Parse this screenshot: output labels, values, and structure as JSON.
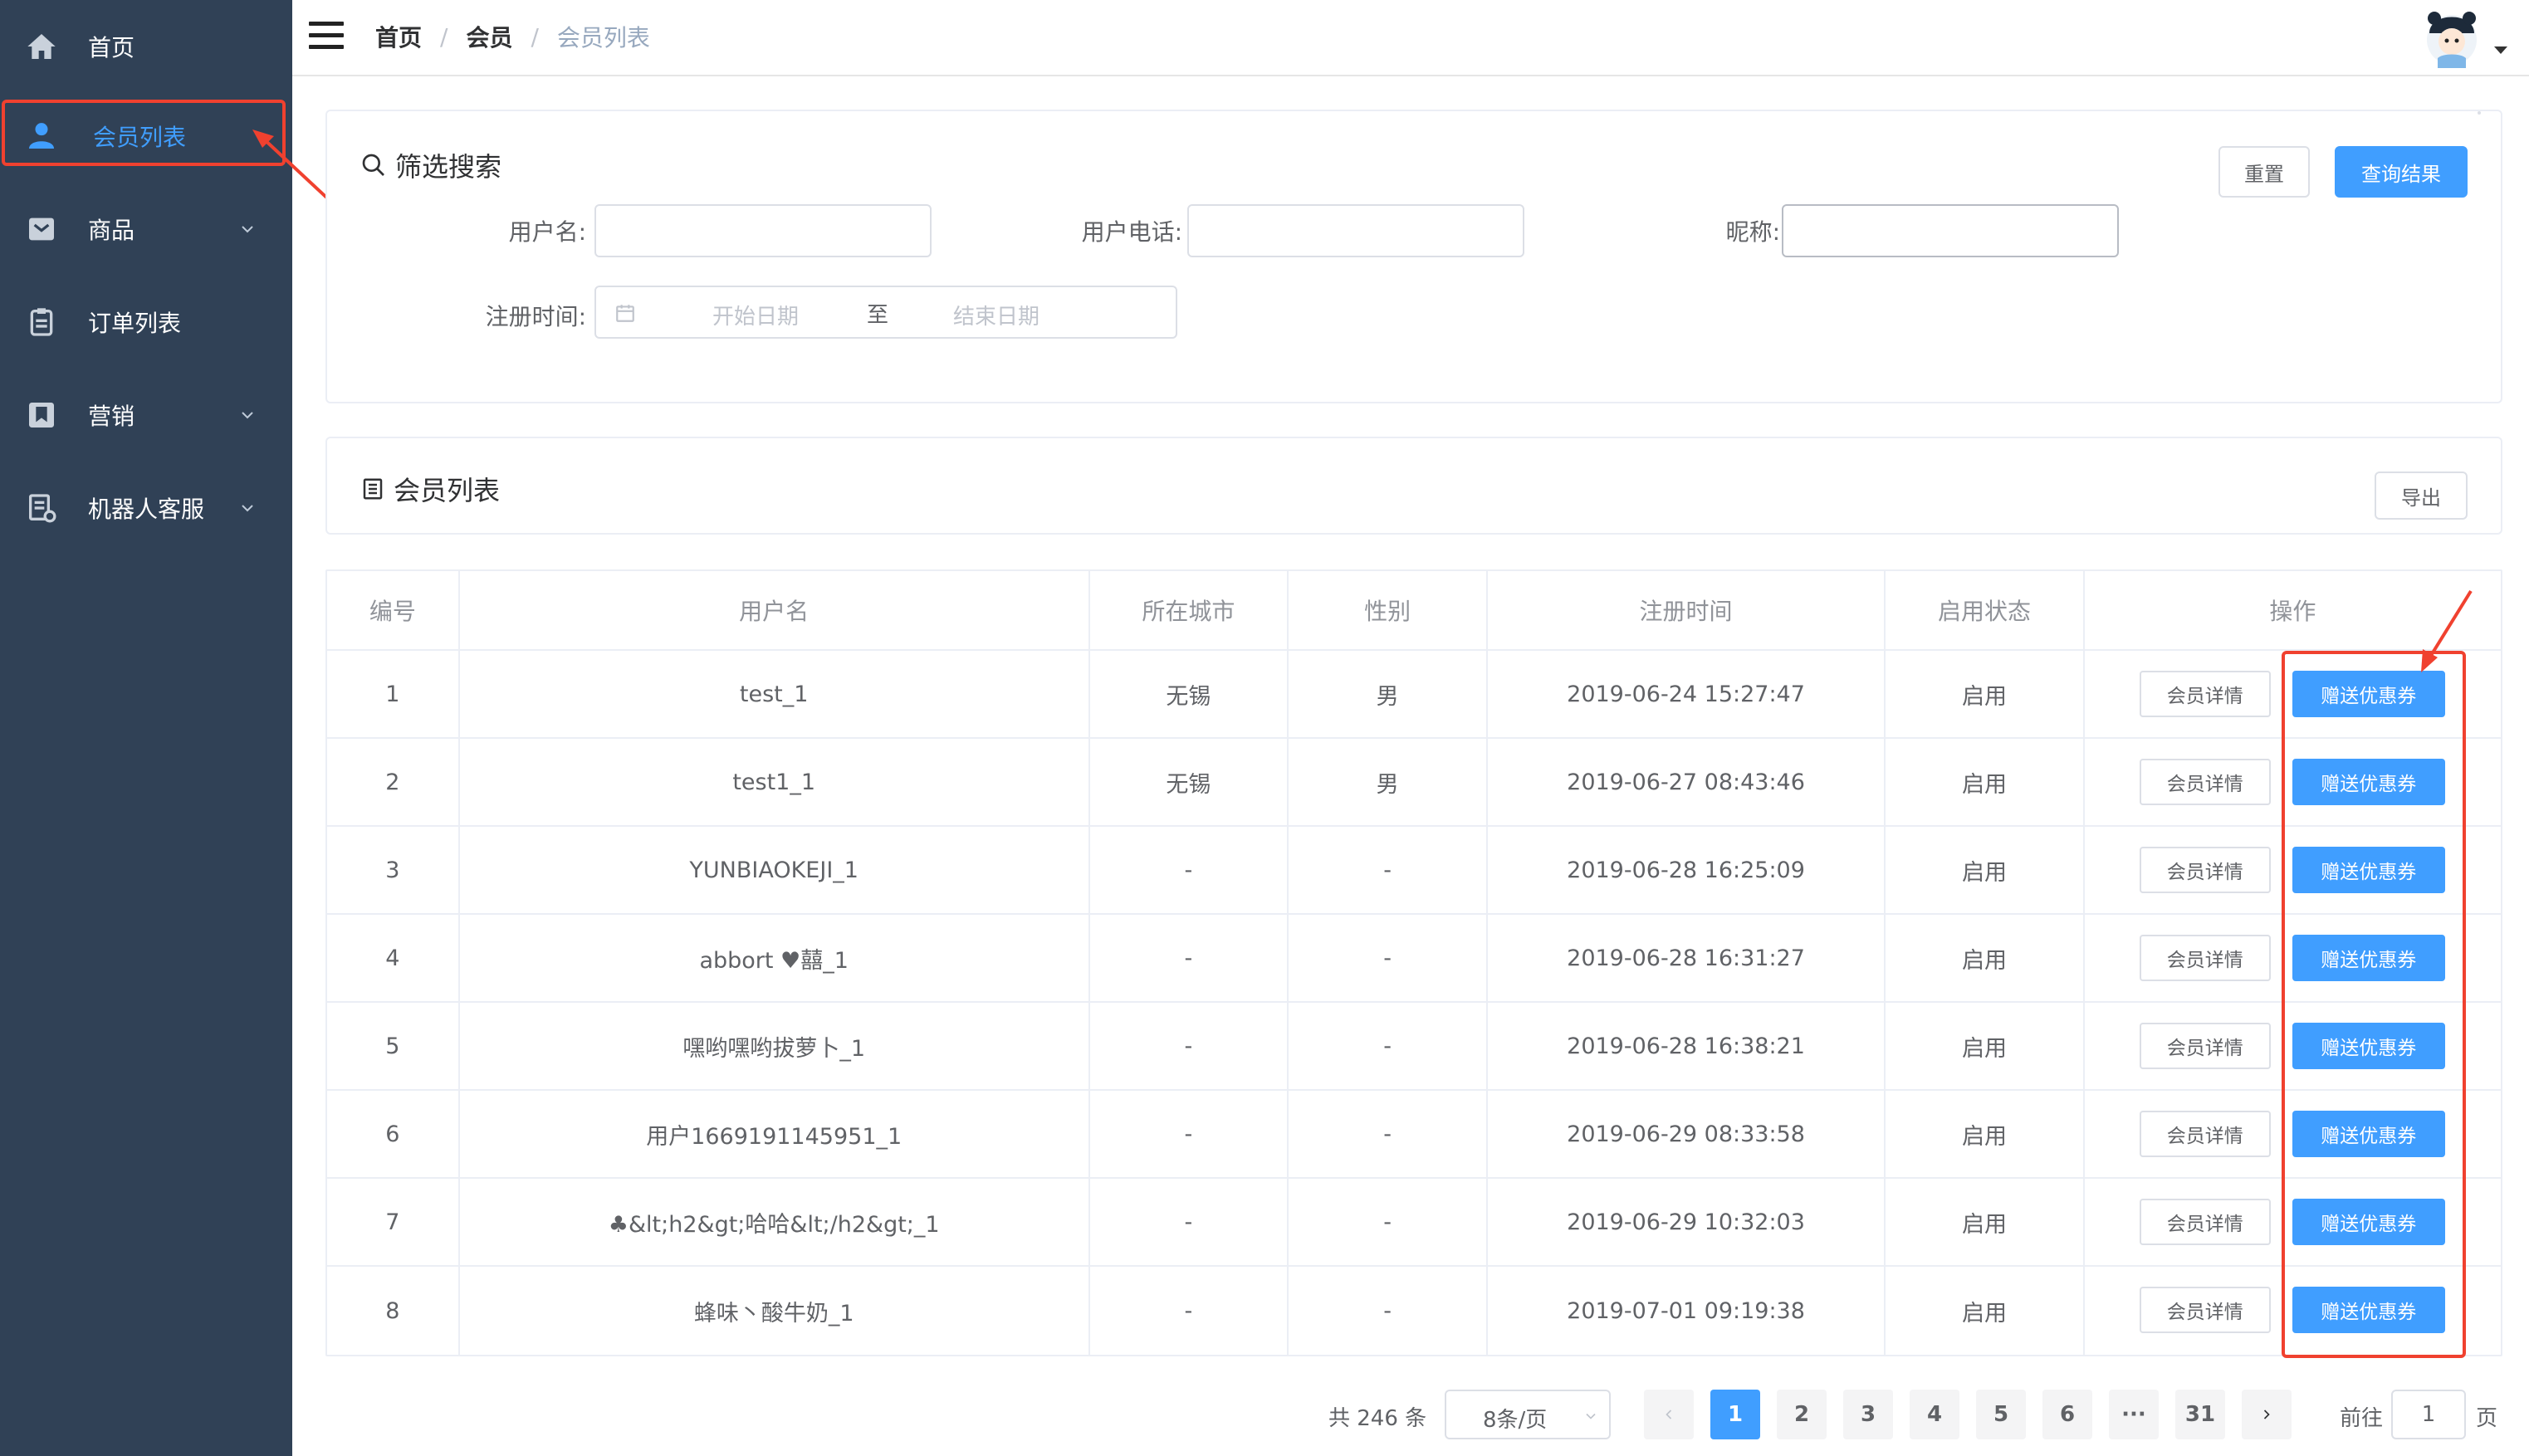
{
  "sidebar": {
    "items": [
      {
        "label": "首页",
        "icon": "home-icon"
      },
      {
        "label": "会员列表",
        "icon": "user-icon",
        "active": true
      },
      {
        "label": "商品",
        "icon": "inbox-icon",
        "has_children": true
      },
      {
        "label": "订单列表",
        "icon": "clipboard-icon"
      },
      {
        "label": "营销",
        "icon": "bookmark-icon",
        "has_children": true
      },
      {
        "label": "机器人客服",
        "icon": "document-icon",
        "has_children": true
      }
    ]
  },
  "header": {
    "breadcrumb": [
      "首页",
      "会员",
      "会员列表"
    ]
  },
  "filter": {
    "title": "筛选搜索",
    "reset_label": "重置",
    "query_label": "查询结果",
    "username_label": "用户名:",
    "phone_label": "用户电话:",
    "nickname_label": "昵称:",
    "regtime_label": "注册时间:",
    "start_placeholder": "开始日期",
    "range_separator": "至",
    "end_placeholder": "结束日期"
  },
  "list": {
    "title": "会员列表",
    "export_label": "导出"
  },
  "table": {
    "columns": [
      "编号",
      "用户名",
      "所在城市",
      "性别",
      "注册时间",
      "启用状态",
      "操作"
    ],
    "detail_label": "会员详情",
    "coupon_label": "赠送优惠券",
    "rows": [
      {
        "id": "1",
        "username": "test_1",
        "city": "无锡",
        "gender": "男",
        "regtime": "2019-06-24 15:27:47",
        "status": "启用"
      },
      {
        "id": "2",
        "username": "test1_1",
        "city": "无锡",
        "gender": "男",
        "regtime": "2019-06-27 08:43:46",
        "status": "启用"
      },
      {
        "id": "3",
        "username": "YUNBIAOKEJI_1",
        "city": "-",
        "gender": "-",
        "regtime": "2019-06-28 16:25:09",
        "status": "启用"
      },
      {
        "id": "4",
        "username": "abbort  ♥囍_1",
        "city": "-",
        "gender": "-",
        "regtime": "2019-06-28 16:31:27",
        "status": "启用"
      },
      {
        "id": "5",
        "username": "嘿哟嘿哟拔萝卜_1",
        "city": "-",
        "gender": "-",
        "regtime": "2019-06-28 16:38:21",
        "status": "启用"
      },
      {
        "id": "6",
        "username": "用户1669191145951_1",
        "city": "-",
        "gender": "-",
        "regtime": "2019-06-29 08:33:58",
        "status": "启用"
      },
      {
        "id": "7",
        "username": "♣&lt;h2&gt;哈哈&lt;/h2&gt;_1",
        "city": "-",
        "gender": "-",
        "regtime": "2019-06-29 10:32:03",
        "status": "启用"
      },
      {
        "id": "8",
        "username": "蜂味丶酸牛奶_1",
        "city": "-",
        "gender": "-",
        "regtime": "2019-07-01 09:19:38",
        "status": "启用"
      }
    ]
  },
  "pagination": {
    "total_text": "共 246 条",
    "page_size": "8条/页",
    "pages": [
      "1",
      "2",
      "3",
      "4",
      "5",
      "6",
      "···",
      "31"
    ],
    "current_page": "1",
    "goto_label": "前往",
    "goto_value": "1",
    "goto_unit": "页"
  },
  "colors": {
    "sidebar_bg": "#304156",
    "primary": "#409EFF",
    "annotation": "#f0412f"
  }
}
